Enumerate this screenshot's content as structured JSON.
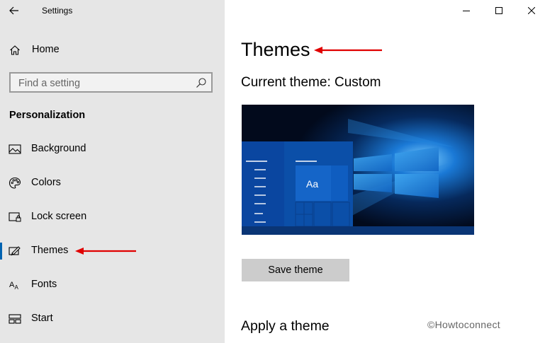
{
  "app": {
    "title": "Settings"
  },
  "window_controls": {
    "minimize": "—",
    "maximize": "□",
    "close": "✕"
  },
  "sidebar": {
    "home_label": "Home",
    "search": {
      "placeholder": "Find a setting",
      "value": ""
    },
    "section_title": "Personalization",
    "items": [
      {
        "label": "Background",
        "icon": "picture-icon",
        "selected": false
      },
      {
        "label": "Colors",
        "icon": "palette-icon",
        "selected": false
      },
      {
        "label": "Lock screen",
        "icon": "lock-screen-icon",
        "selected": false
      },
      {
        "label": "Themes",
        "icon": "brush-icon",
        "selected": true
      },
      {
        "label": "Fonts",
        "icon": "font-icon",
        "selected": false
      },
      {
        "label": "Start",
        "icon": "start-tiles-icon",
        "selected": false
      }
    ]
  },
  "main": {
    "title": "Themes",
    "current_theme": "Current theme: Custom",
    "preview": {
      "sample_text": "Aa"
    },
    "save_button": "Save theme",
    "apply_title": "Apply a theme"
  },
  "watermark": "©Howtoconnect",
  "colors": {
    "accent": "#0063b1",
    "sidebar_bg": "#e6e6e6",
    "annotation_arrow": "#e00000",
    "preview_tiles": "#0b4fa8"
  }
}
